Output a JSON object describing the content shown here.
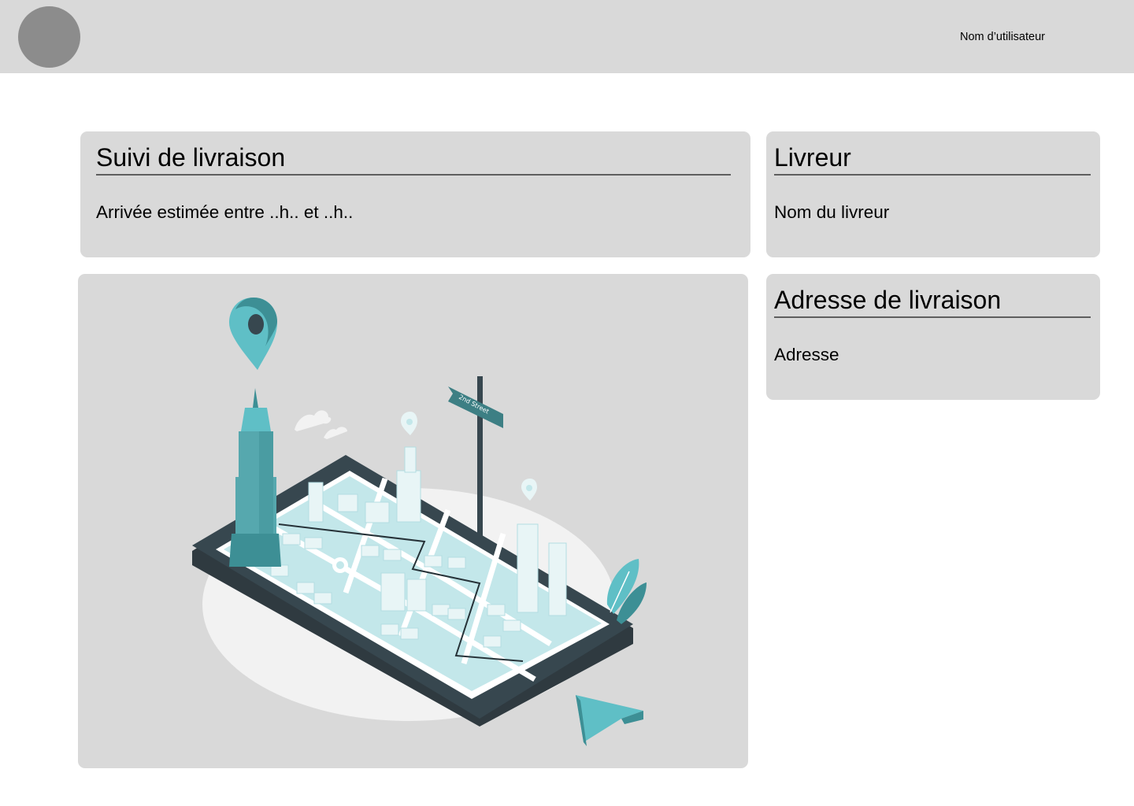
{
  "header": {
    "username": "Nom d’utilisateur",
    "avatar_icon": "user-avatar-placeholder"
  },
  "tracking": {
    "title": "Suivi de livraison",
    "eta_text": "Arrivée estimée entre ..h.. et ..h.."
  },
  "courier": {
    "title": "Livreur",
    "name": "Nom du livreur"
  },
  "address": {
    "title": "Adresse de livraison",
    "value": "Adresse"
  },
  "map": {
    "street_sign": "2nd Street",
    "icons": [
      "location-pin-icon",
      "cursor-arrow-icon",
      "street-sign-icon"
    ],
    "colors": {
      "accent": "#5fbfc6",
      "dark": "#37474f",
      "map_water": "#c3e7ea",
      "background": "#d9d9d9"
    }
  }
}
